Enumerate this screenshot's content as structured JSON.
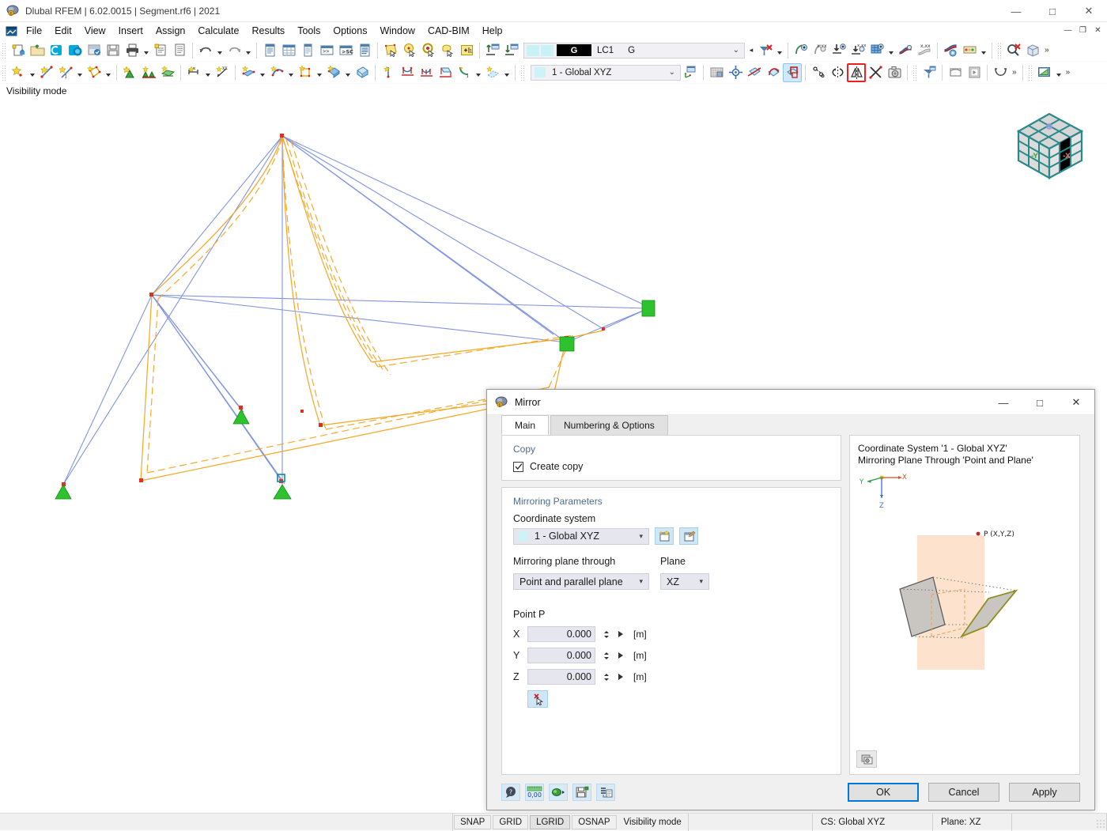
{
  "window": {
    "title": "Dlubal RFEM | 6.02.0015 | Segment.rf6 | 2021",
    "app_icon": "rfem-logo-icon",
    "minimize": "—",
    "maximize": "□",
    "close": "✕"
  },
  "mdi": {
    "minimize": "—",
    "restore": "❐",
    "close": "✕"
  },
  "menu": {
    "items": [
      {
        "label": "File"
      },
      {
        "label": "Edit"
      },
      {
        "label": "View"
      },
      {
        "label": "Insert"
      },
      {
        "label": "Assign"
      },
      {
        "label": "Calculate"
      },
      {
        "label": "Results"
      },
      {
        "label": "Tools"
      },
      {
        "label": "Options"
      },
      {
        "label": "Window"
      },
      {
        "label": "CAD-BIM"
      },
      {
        "label": "Help"
      }
    ]
  },
  "toolbar_main": {
    "load_combo": {
      "tag": "G",
      "code": "LC1",
      "name": "G",
      "chevron": "⌄"
    }
  },
  "toolbar_second": {
    "cs_combo": {
      "value": "1 - Global XYZ",
      "chevron": "⌄"
    },
    "mirror_tool_highlight": "#f02020",
    "overflow": "»"
  },
  "viewport": {
    "status_hint": "Visibility mode",
    "navcube": {
      "label_minus_y": "-Y",
      "label_minus_x": "-X"
    }
  },
  "dialog": {
    "title": "Mirror",
    "icon": "mirror-dialog-icon",
    "minimize": "—",
    "maximize": "□",
    "close": "✕",
    "tabs": [
      {
        "label": "Main",
        "selected": true
      },
      {
        "label": "Numbering & Options",
        "selected": false
      }
    ],
    "copy_group": {
      "heading": "Copy",
      "create_copy_label": "Create copy",
      "create_copy_checked": true
    },
    "mirroring_group": {
      "heading": "Mirroring Parameters",
      "coordinate_system_label": "Coordinate system",
      "coordinate_system_value": "1 - Global XYZ",
      "new_cs_icon": "new-coordinate-system-icon",
      "edit_cs_icon": "edit-coordinate-system-icon",
      "plane_through_label": "Mirroring plane through",
      "plane_through_value": "Point and parallel plane",
      "plane_label": "Plane",
      "plane_value": "XZ",
      "point_label": "Point P",
      "pick_point_icon": "pick-point-icon",
      "fields": [
        {
          "axis": "X",
          "value": "0.000",
          "unit": "[m]"
        },
        {
          "axis": "Y",
          "value": "0.000",
          "unit": "[m]"
        },
        {
          "axis": "Z",
          "value": "0.000",
          "unit": "[m]"
        }
      ]
    },
    "preview": {
      "line1": "Coordinate System '1 - Global XYZ'",
      "line2": "Mirroring Plane Through 'Point and Plane'",
      "axis_x": "X",
      "axis_y": "Y",
      "axis_z": "Z",
      "point_label": "P (X,Y,Z)",
      "snapshot_icon": "snapshot-icon",
      "plane_color": "#fde3cd",
      "mirror_color": "#9a9a2a"
    },
    "footer_icons": [
      {
        "name": "help-icon"
      },
      {
        "name": "units-icon",
        "label": "0,00"
      },
      {
        "name": "settings-icon"
      },
      {
        "name": "save-defaults-icon"
      },
      {
        "name": "details-icon"
      }
    ],
    "buttons": {
      "ok": "OK",
      "cancel": "Cancel",
      "apply": "Apply"
    }
  },
  "statusbar": {
    "toggles": [
      {
        "label": "SNAP",
        "on": false
      },
      {
        "label": "GRID",
        "on": false
      },
      {
        "label": "LGRID",
        "on": true
      },
      {
        "label": "OSNAP",
        "on": false
      }
    ],
    "mode": "Visibility mode",
    "cs": "CS: Global XYZ",
    "plane": "Plane: XZ"
  }
}
